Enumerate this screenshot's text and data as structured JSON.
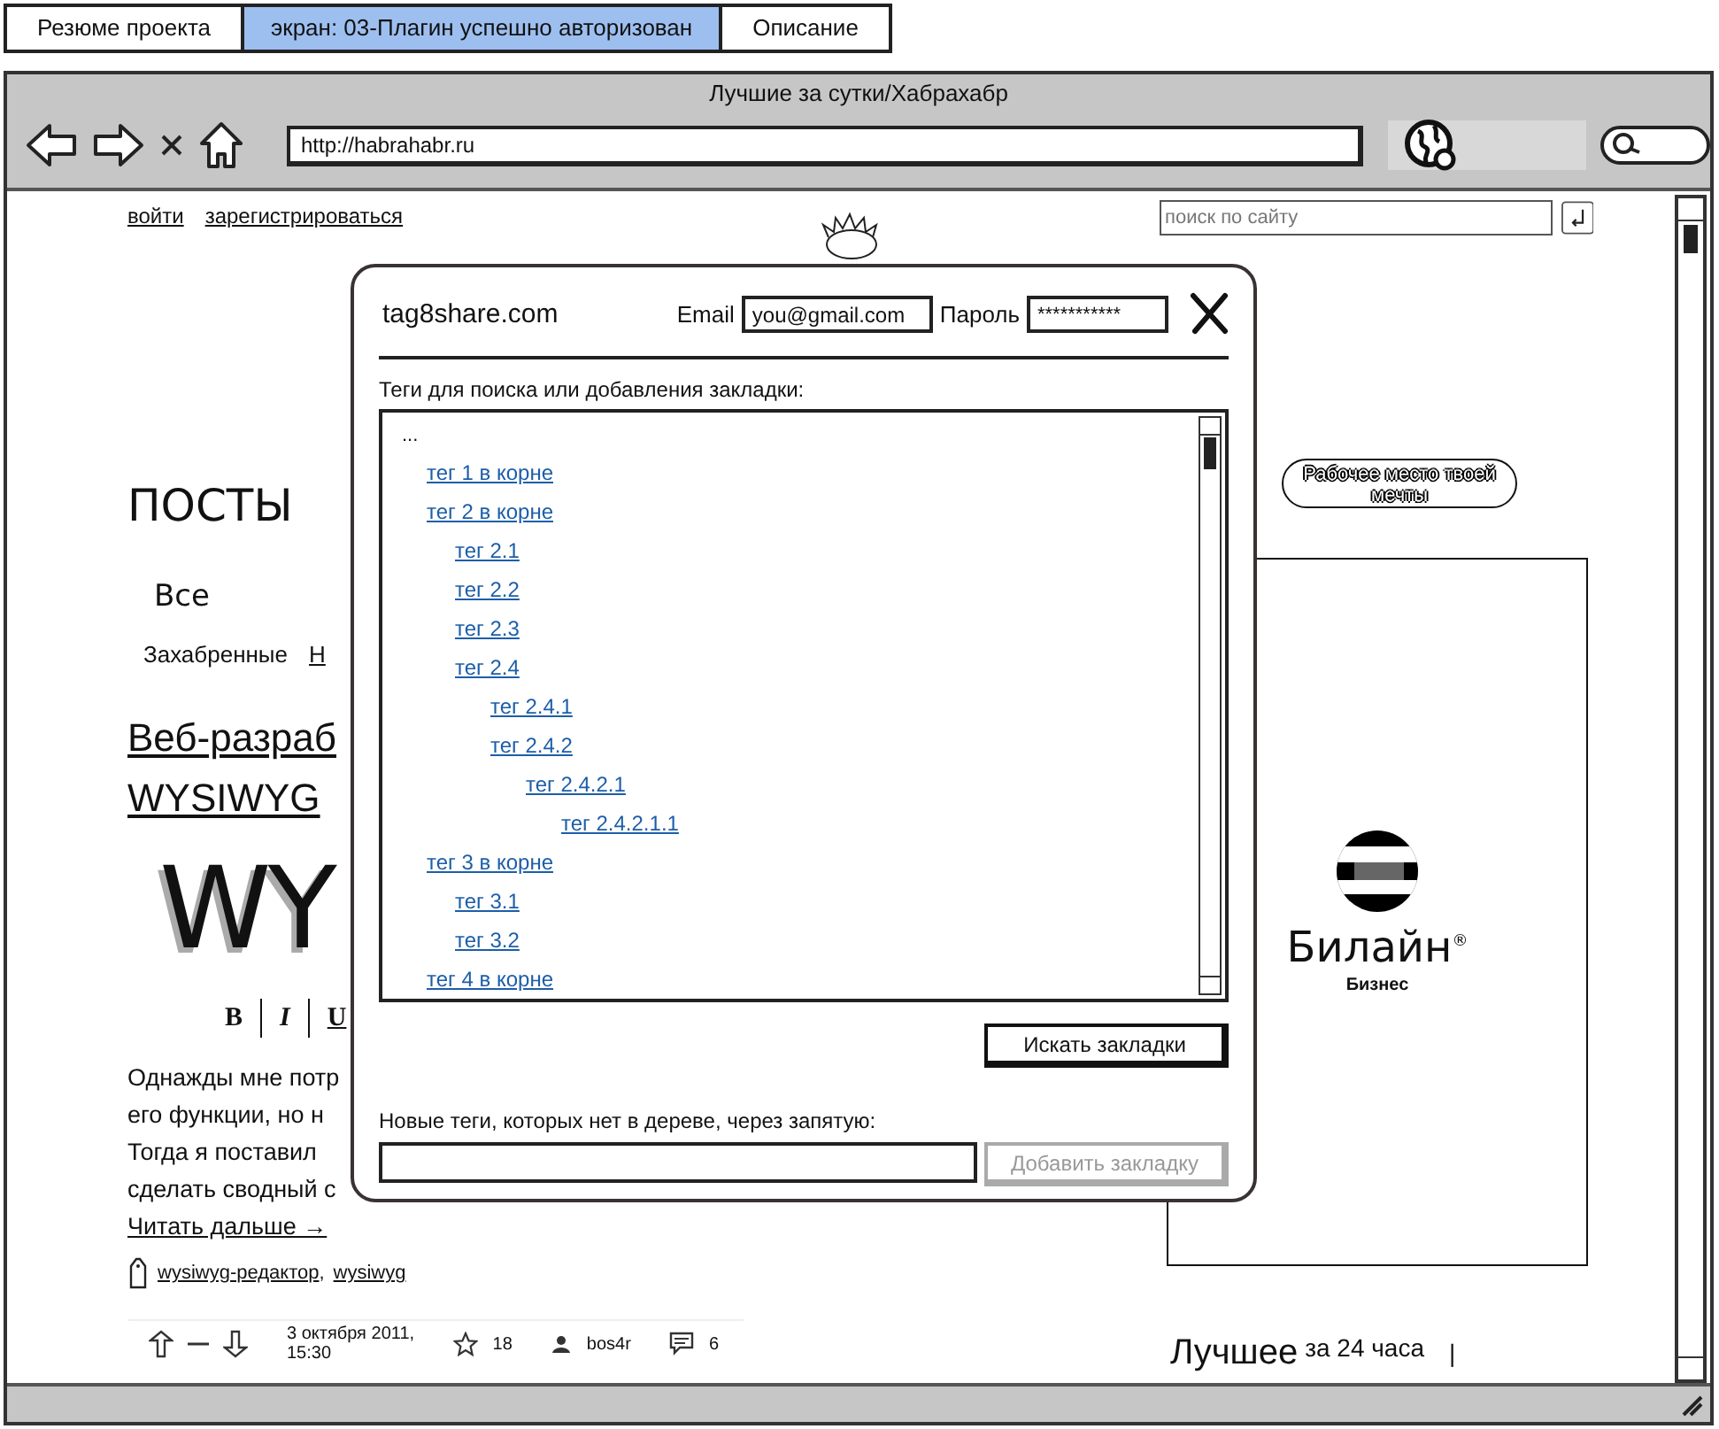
{
  "tabs": [
    {
      "label": "Резюме проекта",
      "selected": false
    },
    {
      "label": "экран: 03-Плагин успешно авторизован",
      "selected": true
    },
    {
      "label": "Описание",
      "selected": false
    }
  ],
  "browser": {
    "title": "Лучшие за сутки/Хабрахабр",
    "url": "http://habrahabr.ru"
  },
  "page": {
    "auth_links": [
      "войти",
      "зарегистрироваться"
    ],
    "site_search": {
      "placeholder": "поиск по сайту"
    },
    "heading": "ПОСТЫ",
    "filters": [
      {
        "label": "Все",
        "kind": "text"
      }
    ],
    "subfilters": [
      {
        "label": "Захабренные",
        "kind": "text"
      },
      {
        "label": "Н",
        "kind": "link"
      }
    ],
    "post": {
      "title_lines": [
        "Веб-разраб",
        "WYSIWYG"
      ],
      "image_text": "WY",
      "toolbar": [
        {
          "label": "B",
          "kind": "bold"
        },
        {
          "label": "I",
          "kind": "italic"
        },
        {
          "label": "U",
          "kind": "underline"
        }
      ],
      "body_lines": [
        "Однажды мне потр",
        "его функции, но н",
        "Тогда я поставил",
        "сделать сводный с"
      ],
      "read_more": "Читать дальше →",
      "tags": [
        {
          "label": "wysiwyg-редактор",
          "suffix": ","
        },
        {
          "label": "wysiwyg"
        }
      ],
      "meta": {
        "date": "3 октября 2011, 15:30",
        "favorites": "18",
        "author": "bos4r",
        "comments": "6"
      }
    },
    "ad_button": "Рабочее место твоей мечты",
    "banner": {
      "brand": "Билайн$^{®}$",
      "subtitle": "Бизнес"
    },
    "best": {
      "title": "Лучшее",
      "period": "за 24 часа",
      "fragment": "|"
    }
  },
  "dialog": {
    "site": "tag8share.com",
    "email_label": "Email",
    "email": "you@gmail.com",
    "password_label": "Пароль",
    "password": "***********",
    "tree_label": "Теги для поиска или добавления закладки:",
    "tree": [
      {
        "label": "...",
        "kind": "text",
        "children": [
          {
            "label": "тег 1 в корне",
            "kind": "link"
          },
          {
            "label": "тег 2 в корне",
            "kind": "link",
            "children": [
              {
                "label": "тег 2.1",
                "kind": "link"
              },
              {
                "label": "тег 2.2",
                "kind": "link"
              },
              {
                "label": "тег 2.3",
                "kind": "link"
              },
              {
                "label": "тег 2.4",
                "kind": "link",
                "children": [
                  {
                    "label": "тег 2.4.1",
                    "kind": "link"
                  },
                  {
                    "label": "тег 2.4.2",
                    "kind": "link",
                    "children": [
                      {
                        "label": "тег 2.4.2.1",
                        "kind": "link",
                        "children": [
                          {
                            "label": "тег 2.4.2.1.1",
                            "kind": "link"
                          }
                        ]
                      }
                    ]
                  }
                ]
              }
            ]
          },
          {
            "label": "тег 3 в корне",
            "kind": "link",
            "children": [
              {
                "label": "тег 3.1",
                "kind": "link"
              },
              {
                "label": "тег 3.2",
                "kind": "link"
              }
            ]
          },
          {
            "label": "тег 4 в корне",
            "kind": "link"
          }
        ]
      }
    ],
    "search_button": "Искать закладки",
    "new_tags_label": "Новые теги, которых нет в дереве, через запятую:",
    "add_button": {
      "label": "Добавить закладку",
      "disabled": true
    }
  }
}
